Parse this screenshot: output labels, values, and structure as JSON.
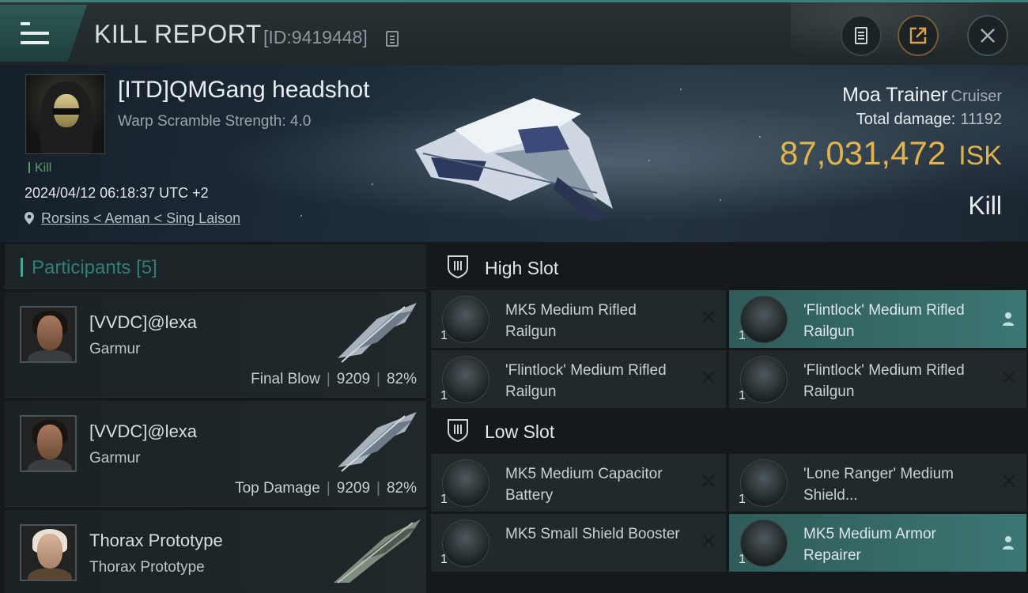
{
  "header": {
    "title": "KILL REPORT",
    "kill_id": "[ID:9419448]",
    "icons": [
      "menu-icon",
      "copy-icon",
      "report-icon",
      "share-icon",
      "close-icon"
    ]
  },
  "victim": {
    "name": "[ITD]QMGang headshot",
    "warp_scramble": "Warp Scramble Strength: 4.0",
    "tag": "Kill",
    "datetime": "2024/04/12 06:18:37 UTC +2",
    "location": "Rorsins < Aeman < Sing Laison",
    "ship_name": "Moa Trainer",
    "ship_class": "Cruiser",
    "total_damage_label": "Total damage:",
    "total_damage": "11192",
    "isk_value": "87,031,472",
    "isk_unit": "ISK",
    "result": "Kill"
  },
  "participants": {
    "label": "Participants",
    "count": "[5]",
    "items": [
      {
        "name": "[VVDC]@lexa",
        "ship": "Garmur",
        "role": "Final Blow",
        "damage": "9209",
        "percent": "82%"
      },
      {
        "name": "[VVDC]@lexa",
        "ship": "Garmur",
        "role": "Top Damage",
        "damage": "9209",
        "percent": "82%"
      },
      {
        "name": "Thorax Prototype",
        "ship": "Thorax Prototype"
      }
    ]
  },
  "fitting": {
    "high_slot": {
      "label": "High Slot",
      "modules": [
        {
          "name": "MK5 Medium Rifled Railgun",
          "qty": "1",
          "state": "destroyed"
        },
        {
          "name": "'Flintlock' Medium Rifled Railgun",
          "qty": "1",
          "state": "dropped"
        },
        {
          "name": "'Flintlock' Medium Rifled Railgun",
          "qty": "1",
          "state": "destroyed"
        },
        {
          "name": "'Flintlock' Medium Rifled Railgun",
          "qty": "1",
          "state": "destroyed"
        }
      ]
    },
    "low_slot": {
      "label": "Low Slot",
      "modules": [
        {
          "name": "MK5 Medium Capacitor Battery",
          "qty": "1",
          "state": "destroyed"
        },
        {
          "name": "'Lone Ranger' Medium Shield...",
          "qty": "1",
          "state": "destroyed"
        },
        {
          "name": "MK5 Small Shield Booster",
          "qty": "1",
          "state": "destroyed"
        },
        {
          "name": "MK5 Medium Armor Repairer",
          "qty": "1",
          "state": "dropped"
        }
      ]
    }
  },
  "colors": {
    "accent": "#3c7774",
    "isk": "#e0b44a",
    "kill_tag": "#5c9a70",
    "participants_label": "#2f7f77"
  }
}
